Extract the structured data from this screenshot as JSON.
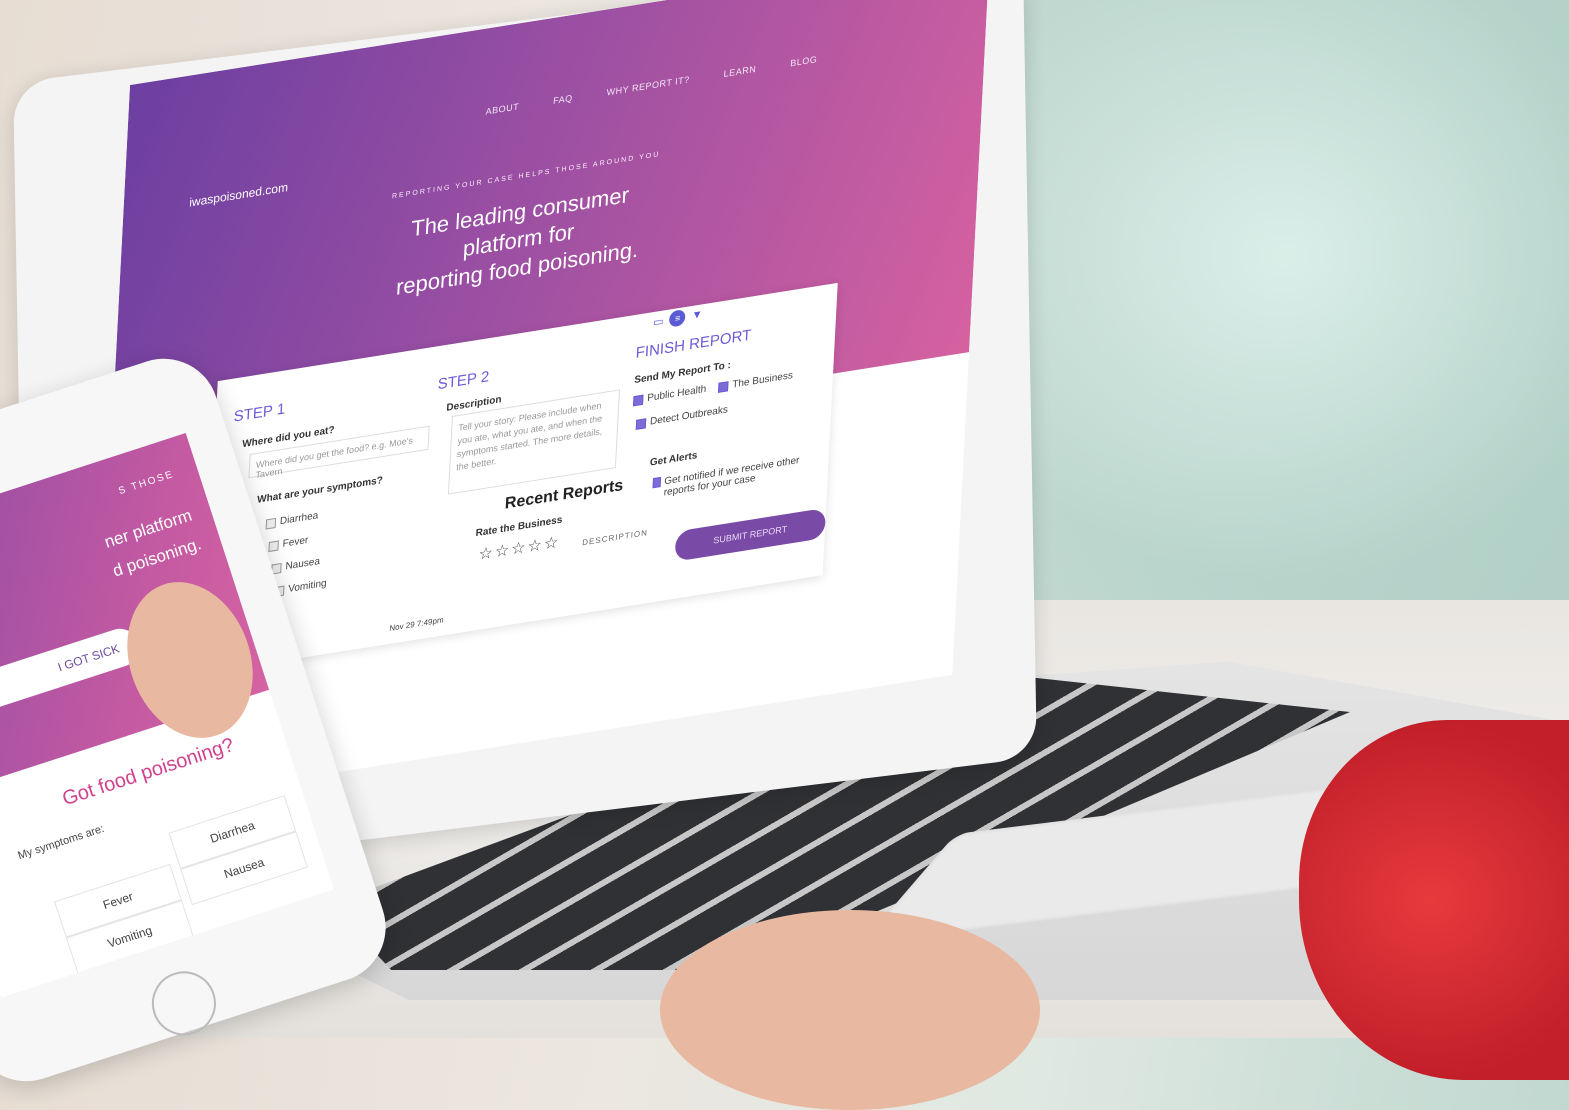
{
  "site": {
    "logo": "iwaspoisoned.com",
    "nav": [
      "ABOUT",
      "FAQ",
      "WHY REPORT IT?",
      "LEARN",
      "BLOG"
    ],
    "tagline": "REPORTING YOUR CASE HELPS THOSE AROUND YOU",
    "headline_line1": "The leading consumer platform for",
    "headline_line2": "reporting food poisoning."
  },
  "step1": {
    "title": "STEP 1",
    "where_label": "Where did you eat?",
    "where_placeholder": "Where did you get the food? e.g. Moe's Tavern",
    "symptoms_label": "What are your symptoms?",
    "symptoms": [
      "Diarrhea",
      "Fever",
      "Nausea",
      "Vomiting"
    ]
  },
  "step2": {
    "title": "STEP 2",
    "description_label": "Description",
    "description_placeholder": "Tell your story: Please include when you ate, what you ate, and when the symptoms started. The more details, the better.",
    "rate_label": "Rate the Business",
    "stars": "☆☆☆☆☆"
  },
  "finish": {
    "title": "FINISH REPORT",
    "send_label": "Send My Report To :",
    "options": [
      "Public Health",
      "The Business",
      "Detect Outbreaks"
    ],
    "alerts_label": "Get Alerts",
    "alerts_option": "Get notified if we receive other reports for your case",
    "submit": "SUBMIT REPORT"
  },
  "recent": {
    "title": "Recent Reports",
    "column": "DESCRIPTION",
    "first_date": "Nov 29 7:49pm"
  },
  "phone": {
    "tagline": "S THOSE",
    "line1": "ner platform",
    "line2": "d poisoning.",
    "button": "I GOT SICK",
    "title": "Got food poisoning?",
    "subtitle": "My symptoms are:",
    "symptoms": [
      "Diarrhea",
      "Fever",
      "Nausea",
      "Vomiting"
    ]
  },
  "colors": {
    "accent": "#6d5ad8",
    "hero_start": "#6c3fa1",
    "hero_end": "#d561a0",
    "phone_title": "#d1418e"
  }
}
